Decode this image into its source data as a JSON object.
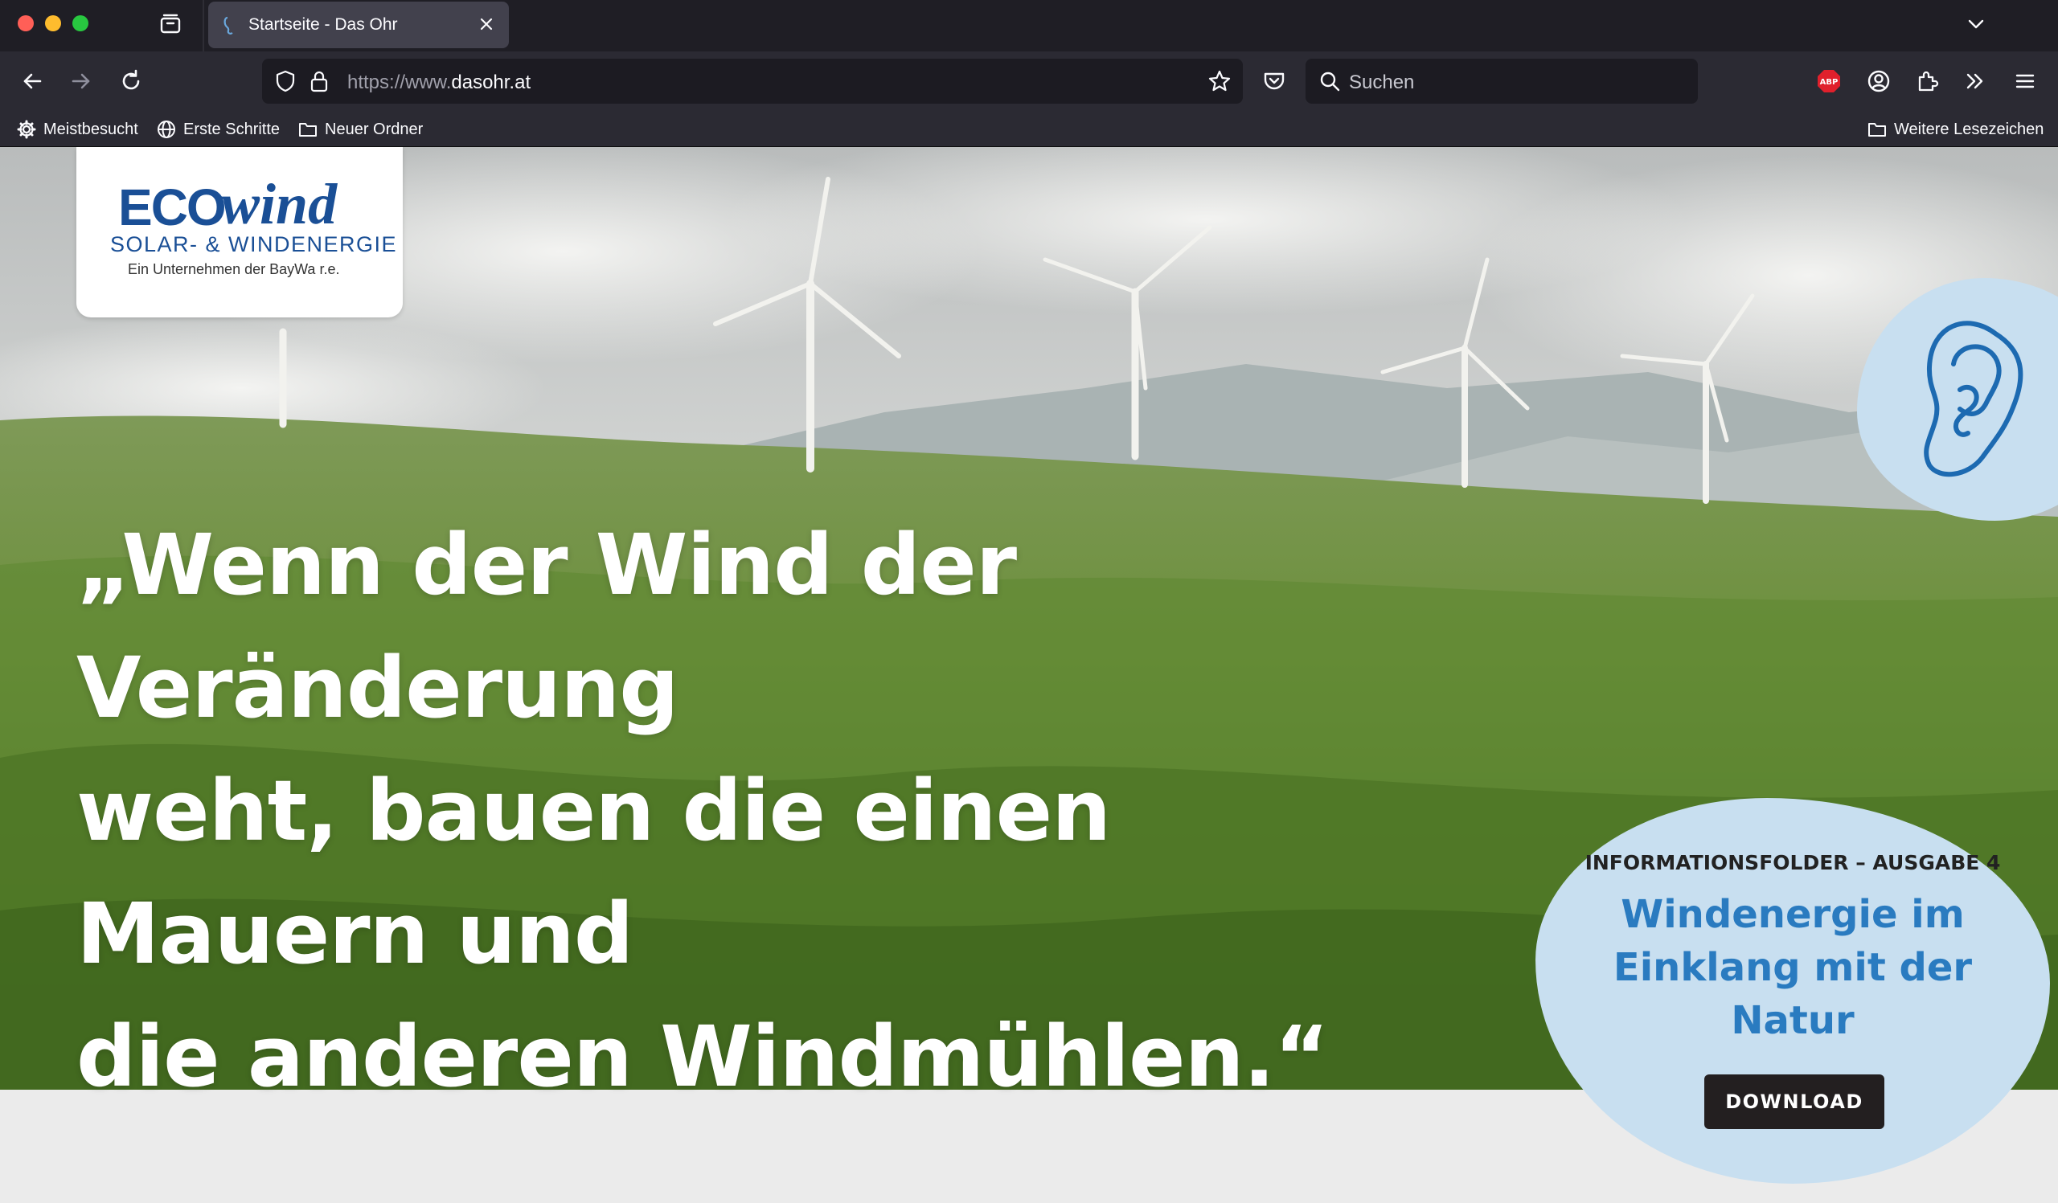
{
  "browser": {
    "tab": {
      "title": "Startseite - Das Ohr"
    },
    "url": {
      "scheme": "https://www.",
      "host": "dasohr.at"
    },
    "search": {
      "placeholder": "Suchen"
    },
    "extensions": {
      "adblock_label": "ABP"
    },
    "bookmarks": [
      {
        "label": "Meistbesucht",
        "icon": "gear-icon"
      },
      {
        "label": "Erste Schritte",
        "icon": "globe-icon"
      },
      {
        "label": "Neuer Ordner",
        "icon": "folder-icon"
      }
    ],
    "bookmarks_right": {
      "label": "Weitere Lesezeichen",
      "icon": "folder-icon"
    }
  },
  "page": {
    "logo": {
      "eco": "ECO",
      "wind": "wind",
      "subtitle": "SOLAR- & WINDENERGIE",
      "tagline": "Ein Unternehmen der BayWa r.e."
    },
    "hero": {
      "quote_line1": "„Wenn der Wind der Veränderung",
      "quote_line2": "weht, bauen die einen Mauern und",
      "quote_line3": "die anderen Windmühlen.“"
    },
    "folder": {
      "kicker": "INFORMATIONSFOLDER – AUSGABE 4",
      "title_line1": "Windenergie im",
      "title_line2": "Einklang mit der",
      "title_line3": "Natur",
      "button_label": "DOWNLOAD"
    }
  },
  "colors": {
    "brand_blue": "#1a4f96",
    "accent_blue": "#2a7bc0",
    "bubble": "#c8dff0",
    "button": "#231f20"
  }
}
